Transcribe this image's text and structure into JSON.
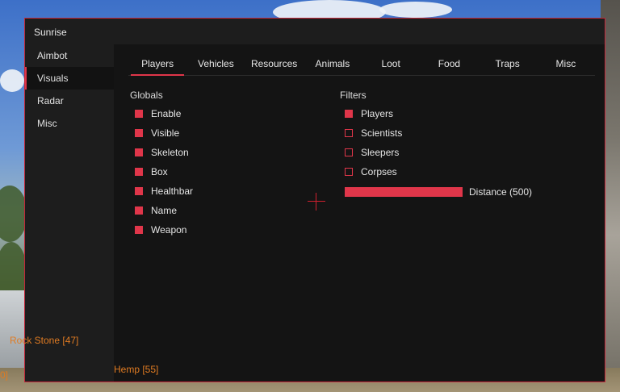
{
  "app": {
    "title": "Sunrise"
  },
  "sidebar": {
    "items": [
      {
        "label": "Aimbot"
      },
      {
        "label": "Visuals"
      },
      {
        "label": "Radar"
      },
      {
        "label": "Misc"
      }
    ]
  },
  "tabs": [
    {
      "label": "Players"
    },
    {
      "label": "Vehicles"
    },
    {
      "label": "Resources"
    },
    {
      "label": "Animals"
    },
    {
      "label": "Loot"
    },
    {
      "label": "Food"
    },
    {
      "label": "Traps"
    },
    {
      "label": "Misc"
    }
  ],
  "globals": {
    "title": "Globals",
    "items": [
      {
        "label": "Enable",
        "checked": true
      },
      {
        "label": "Visible",
        "checked": true
      },
      {
        "label": "Skeleton",
        "checked": true
      },
      {
        "label": "Box",
        "checked": true
      },
      {
        "label": "Healthbar",
        "checked": true
      },
      {
        "label": "Name",
        "checked": true
      },
      {
        "label": "Weapon",
        "checked": true
      }
    ]
  },
  "filters": {
    "title": "Filters",
    "items": [
      {
        "label": "Players",
        "checked": true
      },
      {
        "label": "Scientists",
        "checked": false
      },
      {
        "label": "Sleepers",
        "checked": false
      },
      {
        "label": "Corpses",
        "checked": false
      }
    ],
    "distance": {
      "label": "Distance (500)",
      "value": 500,
      "fill_fraction": 1.0
    }
  },
  "world_labels": {
    "rock": "Rock Stone [47]",
    "hemp": "Hemp [55]",
    "edge": "0]"
  },
  "colors": {
    "accent": "#e0364a",
    "panel": "#141414",
    "sidebar": "#1d1d1d",
    "world_label": "#e07b22"
  }
}
